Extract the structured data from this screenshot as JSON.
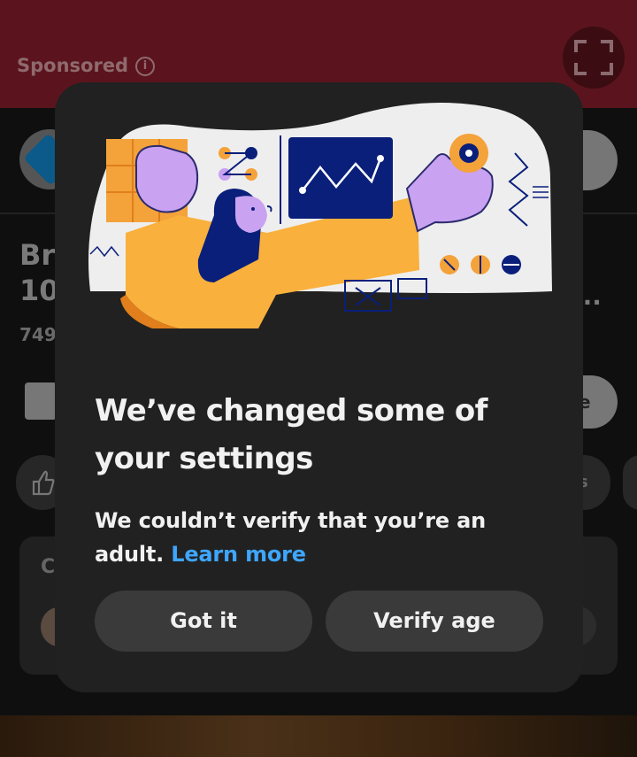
{
  "ad": {
    "sponsored_label": "Sponsored",
    "info_icon": "info-icon",
    "fullscreen_icon": "fullscreen-icon",
    "banner_color": "#5b141d"
  },
  "background_page": {
    "title_fragment_line1": "Br",
    "title_fragment_line2": "10",
    "views_fragment": "749",
    "more_fragment": "...",
    "save_fragment": "e",
    "chip_fragment": "s",
    "comments_fragment": "C",
    "like_icon": "thumbs-up-icon",
    "channel_logo": "dominos-logo"
  },
  "dialog": {
    "heading": "We’ve changed some of your settings",
    "message": "We couldn’t verify that you’re an adult.",
    "link_label": "Learn more",
    "link_color": "#3ea6ff",
    "buttons": {
      "got_it": "Got it",
      "verify_age": "Verify age"
    }
  }
}
